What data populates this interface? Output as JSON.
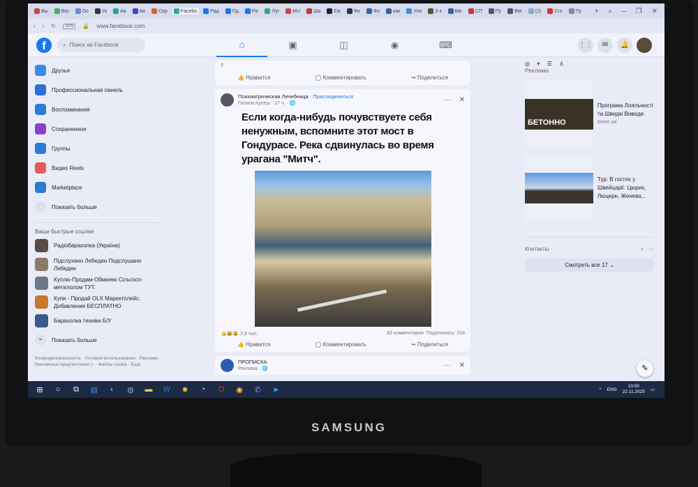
{
  "monitor": {
    "brand": "SAMSUNG"
  },
  "browser": {
    "tabs": [
      "Вы",
      "Вкс",
      "Ос",
      "Ук",
      "Ав",
      "Ав",
      "Сер",
      "Facebo",
      "Рад",
      "Пд",
      "Ріс",
      "Луг",
      "МU",
      "Ша",
      "Еж",
      "Фо",
      "Фо",
      "как",
      "Ули",
      "З к",
      "Вів",
      "СП",
      "Пу",
      "Вte",
      "(2)",
      "Сго",
      "Пу"
    ],
    "active_tab": 7,
    "url": "www.facebook.com",
    "vpn": "VPN"
  },
  "header": {
    "search_placeholder": "Поиск на Facebook"
  },
  "sidebar": {
    "items": [
      {
        "label": "Друзья",
        "color": "#3b8be8"
      },
      {
        "label": "Профессиональная панель",
        "color": "#2a6fd6"
      },
      {
        "label": "Воспоминания",
        "color": "#2a7ad6"
      },
      {
        "label": "Сохраненное",
        "color": "#8a3fd0"
      },
      {
        "label": "Группы",
        "color": "#2a7ad6"
      },
      {
        "label": "Видео Reels",
        "color": "#e45a5a"
      },
      {
        "label": "Marketplace",
        "color": "#2a7ad6"
      },
      {
        "label": "Показать больше",
        "color": "#dde1ee"
      }
    ],
    "shortcuts_title": "Ваши быстрые ссылки",
    "shortcuts": [
      {
        "label": "Радіобарахолка (Україна)",
        "color": "#5a4a4a"
      },
      {
        "label": "Підслухано Лебедин Подслушано Лебедин",
        "color": "#8a7a6a"
      },
      {
        "label": "Куплю-Продам-Обміняю Сільгосп-металолом ТУТ.",
        "color": "#6a7a8a"
      },
      {
        "label": "Купи - Продай OLX Маркетплейс. Добавление БЕСПЛАТНО",
        "color": "#c9772a"
      },
      {
        "label": "Барахолка техніки Б/У",
        "color": "#3a5a8a"
      }
    ],
    "show_more": "Показать больше",
    "footer": "Конфиденциальность · Условия использования · Реклама · Рекламные предпочтения ▷ · Файлы cookie · Ещё"
  },
  "feed": {
    "prev_post": {
      "reactions": "3",
      "like": "Нравится",
      "comment": "Комментировать",
      "share": "Поделиться"
    },
    "post": {
      "group": "Психиатрическая Лечебница",
      "join": "· Присоединиться",
      "author": "Галина Кулеш · 17 ч. · 🌐",
      "text": "Если когда-нибудь почувствуете себя ненужным, вспомните этот мост в Гондурасе. Река сдвинулась во время урагана \"Митч\".",
      "reactions": "2,9 тыс.",
      "comments": "83 комментария",
      "shares": "Поделились: 258",
      "like": "Нравится",
      "comment": "Комментировать",
      "share": "Поделиться"
    },
    "next_post": {
      "name": "ПРОПИСКА",
      "sub": "Реклама · 🌐"
    }
  },
  "right": {
    "ads_title": "Реклама",
    "ads": [
      {
        "title": "Програма Лояльності та Швидкі Виводи.",
        "domain": "beton.ua",
        "image_text": "БЕТОННО"
      },
      {
        "title": "Тур: В гостях у Швейцарії: Цюрих, Люцерн, Женева...",
        "domain": ""
      }
    ],
    "contacts_title": "Контакты",
    "see_all": "Смотреть все 17 ⌄"
  },
  "taskbar": {
    "lang": "ENG",
    "time": "13:50",
    "date": "22.11.2025"
  }
}
